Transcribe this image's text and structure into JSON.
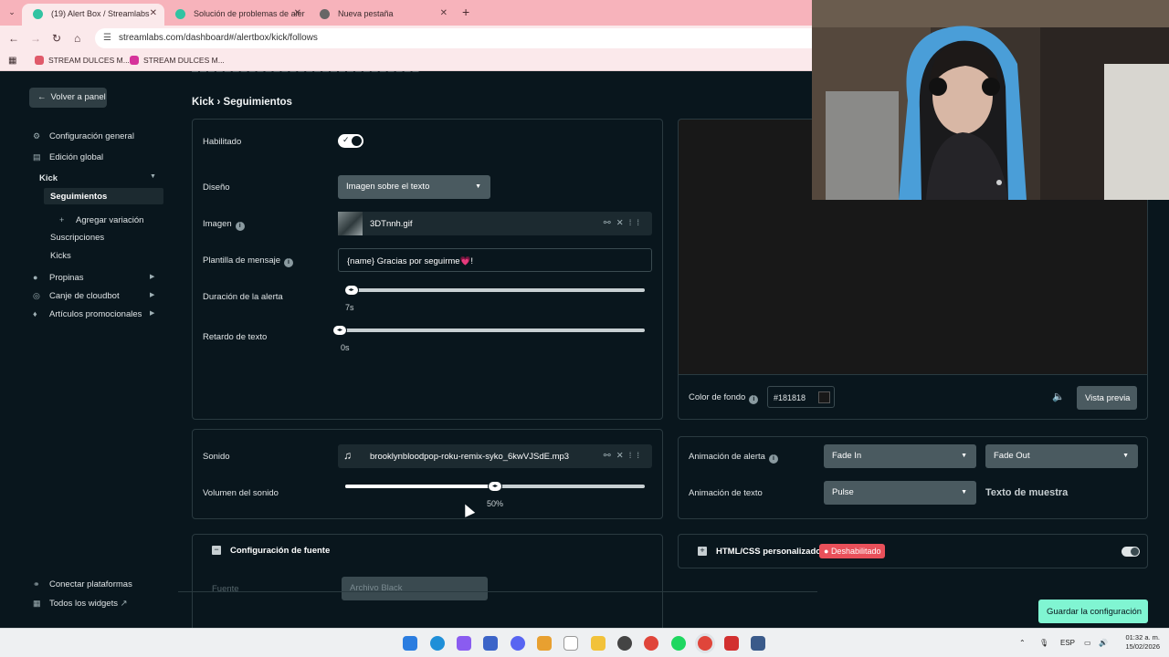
{
  "browser": {
    "tabs": [
      {
        "title": "(19) Alert Box / Streamlabs",
        "favicon_color": "#31c3a2"
      },
      {
        "title": "Solución de problemas de aler",
        "favicon_color": "#31c3a2"
      },
      {
        "title": "Nueva pestaña",
        "favicon_color": "#555555"
      }
    ],
    "url": "streamlabs.com/dashboard#/alertbox/kick/follows",
    "bookmarks": [
      {
        "label": "STREAM DULCES M...",
        "icon_color": "#e05a6a"
      },
      {
        "label": "STREAM DULCES M...",
        "icon_color": "#d6339b"
      }
    ]
  },
  "sidebar": {
    "back": "Volver a panel",
    "items": [
      {
        "label": "Configuración general",
        "icon": "gear-icon"
      },
      {
        "label": "Edición global",
        "icon": "grid-icon"
      },
      {
        "label": "Kick"
      },
      {
        "label": "Seguimientos"
      },
      {
        "label": "Agregar variación",
        "icon": "plus-icon"
      },
      {
        "label": "Suscripciones"
      },
      {
        "label": "Kicks"
      },
      {
        "label": "Propinas",
        "icon": "tip-icon"
      },
      {
        "label": "Canje de cloudbot",
        "icon": "cloudbot-icon"
      },
      {
        "label": "Artículos promocionales",
        "icon": "shirt-icon"
      }
    ],
    "bottom": [
      {
        "label": "Conectar plataformas",
        "icon": "link-icon"
      },
      {
        "label": "Todos los widgets",
        "icon": "widgets-icon"
      }
    ]
  },
  "breadcrumb": {
    "parent": "Kick",
    "sep": "›",
    "current": "Seguimientos"
  },
  "settings": {
    "enabled_label": "Habilitado",
    "layout_label": "Diseño",
    "layout_value": "Imagen sobre el texto",
    "image_label": "Imagen",
    "image_file": "3DTnnh.gif",
    "template_label": "Plantilla de mensaje",
    "template_value": "{name} Gracias por seguirme💗!",
    "duration_label": "Duración de la alerta",
    "duration_value": "7s",
    "duration_fraction": 0.02,
    "text_delay_label": "Retardo de texto",
    "text_delay_value": "0s",
    "text_delay_fraction": 0.0
  },
  "sound": {
    "label": "Sonido",
    "file": "brooklynbloodpop-roku-remix-syko_6kwVJSdE.mp3",
    "volume_label": "Volumen del sonido",
    "volume_value": "50%",
    "volume_fraction": 0.5
  },
  "font_section": {
    "title": "Configuración de fuente",
    "font_label": "Fuente",
    "font_value": "Archivo Black"
  },
  "preview": {
    "bg_label": "Color de fondo",
    "bg_value": "#181818",
    "preview_button": "Vista previa"
  },
  "animation": {
    "alert_label": "Animación de alerta",
    "alert_in": "Fade In",
    "alert_out": "Fade Out",
    "text_label": "Animación de texto",
    "text_value": "Pulse",
    "sample_text": "Texto de muestra"
  },
  "custom_code": {
    "label": "HTML/CSS personalizado",
    "status": "Deshabilitado"
  },
  "save_button": "Guardar la configuración",
  "taskbar": {
    "lang": "ESP",
    "time": "01:32 a. m.",
    "date": "15/02/2026"
  }
}
